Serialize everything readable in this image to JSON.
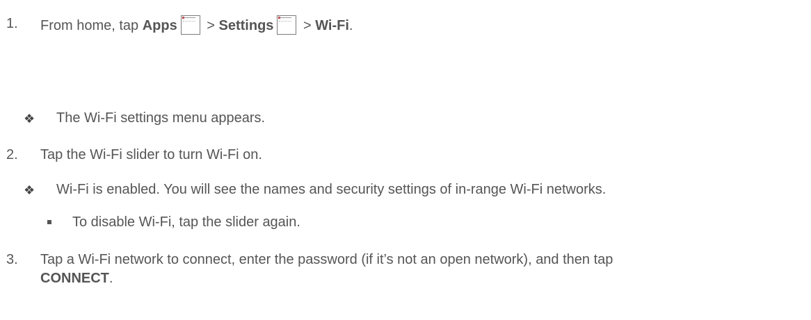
{
  "steps": [
    {
      "number": "1.",
      "parts": {
        "t1": "From home, tap ",
        "b1": "Apps",
        "sep1": " > ",
        "b2": "Settings",
        "sep2": " > ",
        "b3": "Wi-Fi",
        "end": "."
      },
      "icons": [
        "apps-icon",
        "settings-icon"
      ],
      "result": "The Wi-Fi settings menu appears."
    },
    {
      "number": "2.",
      "text": "Tap the Wi-Fi slider to turn Wi-Fi on.",
      "result": "Wi-Fi is enabled. You will see the names and security settings of in-range Wi-Fi networks.",
      "note": "To disable Wi-Fi, tap the slider again."
    },
    {
      "number": "3.",
      "text": "Tap a Wi-Fi network to connect, enter the password (if it’s not an open network), and then tap",
      "bold_end": "CONNECT",
      "end": "."
    }
  ],
  "colors": {
    "text": "#555555",
    "bullet": "#444444"
  }
}
